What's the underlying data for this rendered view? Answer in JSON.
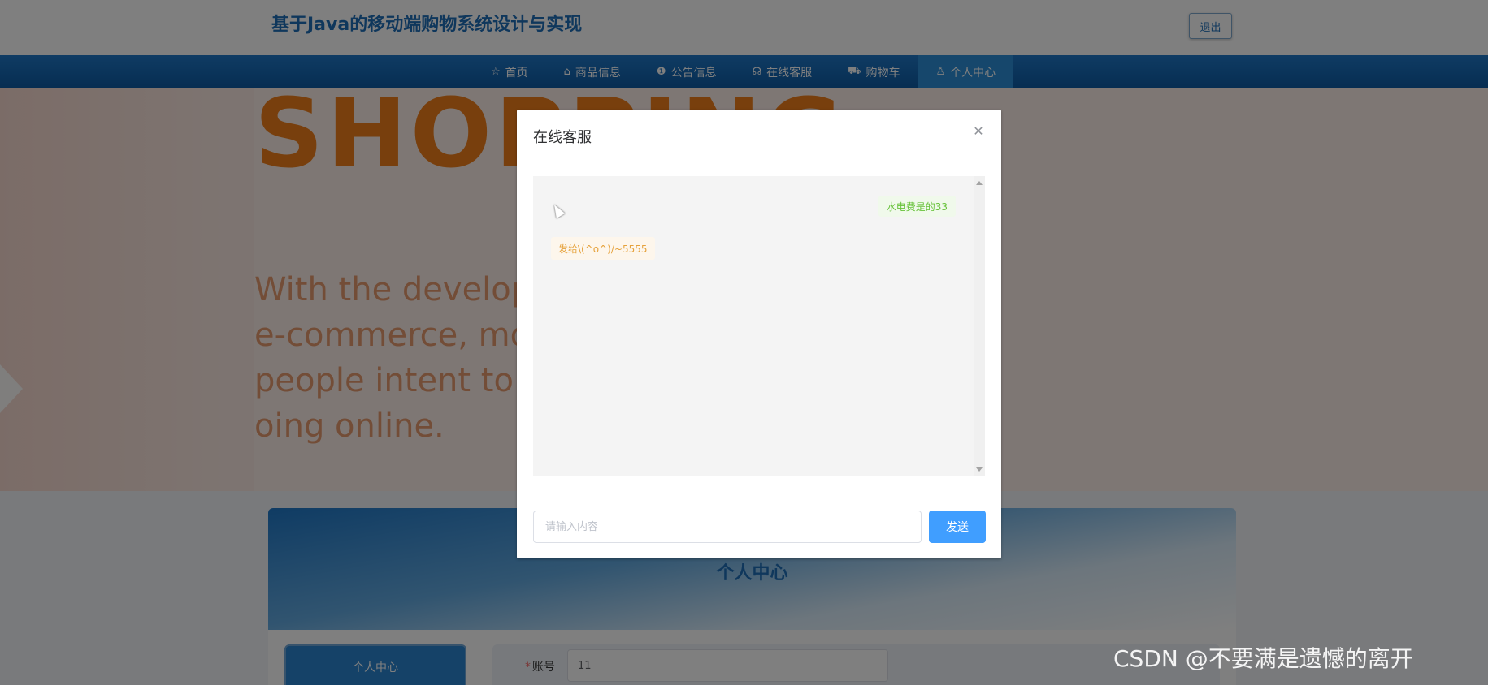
{
  "header": {
    "site_title": "基于Java的移动端购物系统设计与实现",
    "logout_label": "退出"
  },
  "nav": {
    "items": [
      {
        "label": "首页",
        "icon": "star-icon",
        "glyph": "☆"
      },
      {
        "label": "商品信息",
        "icon": "bag-icon",
        "glyph": "⌂"
      },
      {
        "label": "公告信息",
        "icon": "info-icon",
        "glyph": "❶"
      },
      {
        "label": "在线客服",
        "icon": "headset-icon",
        "glyph": "☊"
      },
      {
        "label": "购物车",
        "icon": "cart-icon",
        "glyph": "⛟"
      },
      {
        "label": "个人中心",
        "icon": "user-icon",
        "glyph": "♙"
      }
    ],
    "active_index": 5
  },
  "banner": {
    "headline": "SHOPPING",
    "text": "With the develop\ne-commerce, more\npeople intent to\noing online."
  },
  "panel": {
    "title": "个人中心",
    "side_tab": "个人中心",
    "account_label": "账号",
    "account_value": "11"
  },
  "dialog": {
    "title": "在线客服",
    "messages": [
      {
        "side": "right",
        "text": "水电费是的33"
      },
      {
        "side": "left",
        "text": "发给\\(^o^)/~5555"
      }
    ],
    "input_placeholder": "请输入内容",
    "send_label": "发送"
  },
  "watermark": "CSDN @不要满是遗憾的离开"
}
